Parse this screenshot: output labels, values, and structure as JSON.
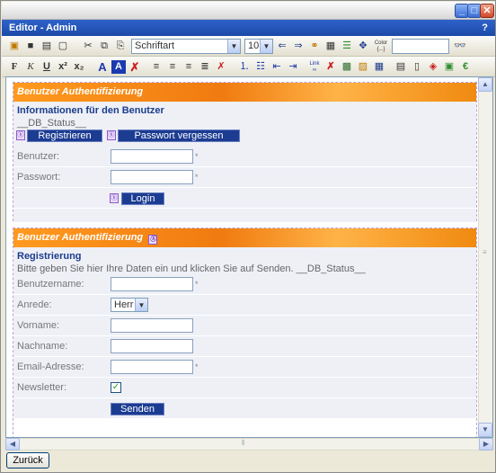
{
  "window": {
    "title": "Editor - Admin",
    "help": "?"
  },
  "toolbar": {
    "font_family": "Schriftart",
    "font_size": "10",
    "color_label": "Color",
    "link_label": "Link",
    "colors": {
      "accent": "#1c3c92",
      "banner": "#f07b10"
    }
  },
  "section1": {
    "banner": "Benutzer Authentifizierung",
    "heading": "Informationen für den Benutzer",
    "status": "__DB_Status__",
    "register_btn": "Registrieren",
    "forgot_btn": "Passwort vergessen",
    "user_label": "Benutzer:",
    "password_label": "Passwort:",
    "login_btn": "Login"
  },
  "section2": {
    "banner": "Benutzer Authentifizierung",
    "heading": "Registrierung",
    "intro": "Bitte geben Sie hier Ihre Daten ein und klicken Sie auf Senden. __DB_Status__",
    "fields": {
      "username": "Benutzername:",
      "salutation": "Anrede:",
      "salutation_value": "Herr",
      "firstname": "Vorname:",
      "lastname": "Nachname:",
      "email": "Email-Adresse:",
      "newsletter": "Newsletter:"
    },
    "send_btn": "Senden"
  },
  "required_mark": "*",
  "bottom": {
    "back_btn": "Zurück"
  }
}
